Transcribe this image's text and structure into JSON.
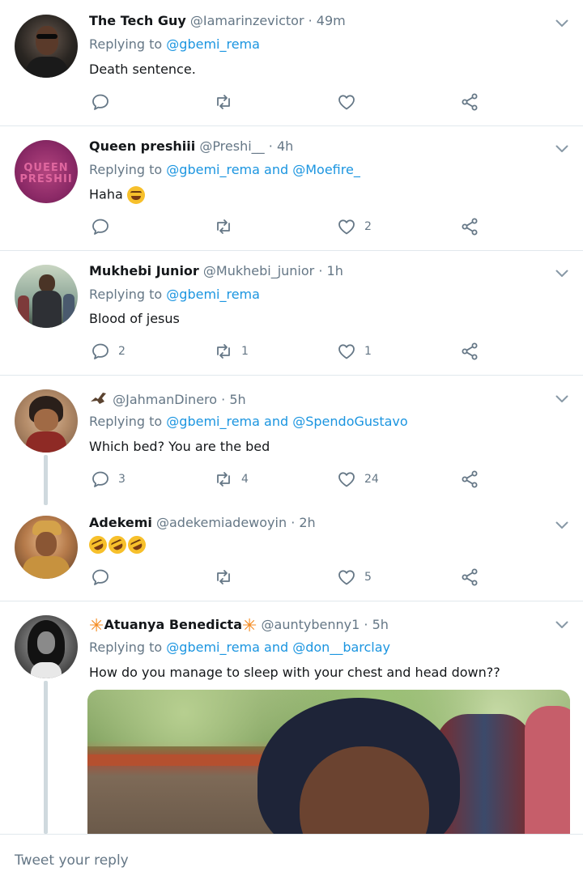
{
  "replying_prefix": "Replying to ",
  "and": " and ",
  "reply_placeholder": "Tweet your reply",
  "tweets": [
    {
      "name": "The Tech Guy",
      "handle": "@Iamarinzevictor",
      "time": "· 49m",
      "reply_to": [
        "@gbemi_rema"
      ],
      "text": "Death sentence.",
      "reply_count": "",
      "retweet_count": "",
      "like_count": ""
    },
    {
      "name": "Queen preshiii",
      "handle": "@Preshi__",
      "time": "· 4h",
      "reply_to": [
        "@gbemi_rema",
        "@Moefire_"
      ],
      "text": "Haha",
      "avatar_text": "QUEEN PRESHII",
      "reply_count": "",
      "retweet_count": "",
      "like_count": "2"
    },
    {
      "name": "Mukhebi Junior",
      "handle": "@Mukhebi_junior",
      "time": "· 1h",
      "reply_to": [
        "@gbemi_rema"
      ],
      "text": "Blood of jesus",
      "reply_count": "2",
      "retweet_count": "1",
      "like_count": "1"
    },
    {
      "name": "",
      "handle": "@JahmanDinero",
      "time": "· 5h",
      "reply_to": [
        "@gbemi_rema",
        "@SpendoGustavo"
      ],
      "text": "Which bed? You are the bed",
      "reply_count": "3",
      "retweet_count": "4",
      "like_count": "24"
    },
    {
      "name": "Adekemi",
      "handle": "@adekemiadewoyin",
      "time": "· 2h",
      "text": "",
      "reply_count": "",
      "retweet_count": "",
      "like_count": "5"
    },
    {
      "name": "Atuanya Benedicta",
      "handle": "@auntybenny1",
      "time": "· 5h",
      "reply_to": [
        "@gbemi_rema",
        "@don__barclay"
      ],
      "text": "How do you manage to sleep with your chest and head down??"
    }
  ],
  "colors": {
    "link": "#1b95e0",
    "muted": "#657786",
    "divider": "#e1e8ed",
    "text": "#14171a"
  },
  "icons": [
    "reply-icon",
    "retweet-icon",
    "like-icon",
    "share-icon",
    "chevron-down-icon",
    "laughing-emoji-icon",
    "rofl-emoji-icon",
    "bird-icon",
    "star-icon"
  ]
}
